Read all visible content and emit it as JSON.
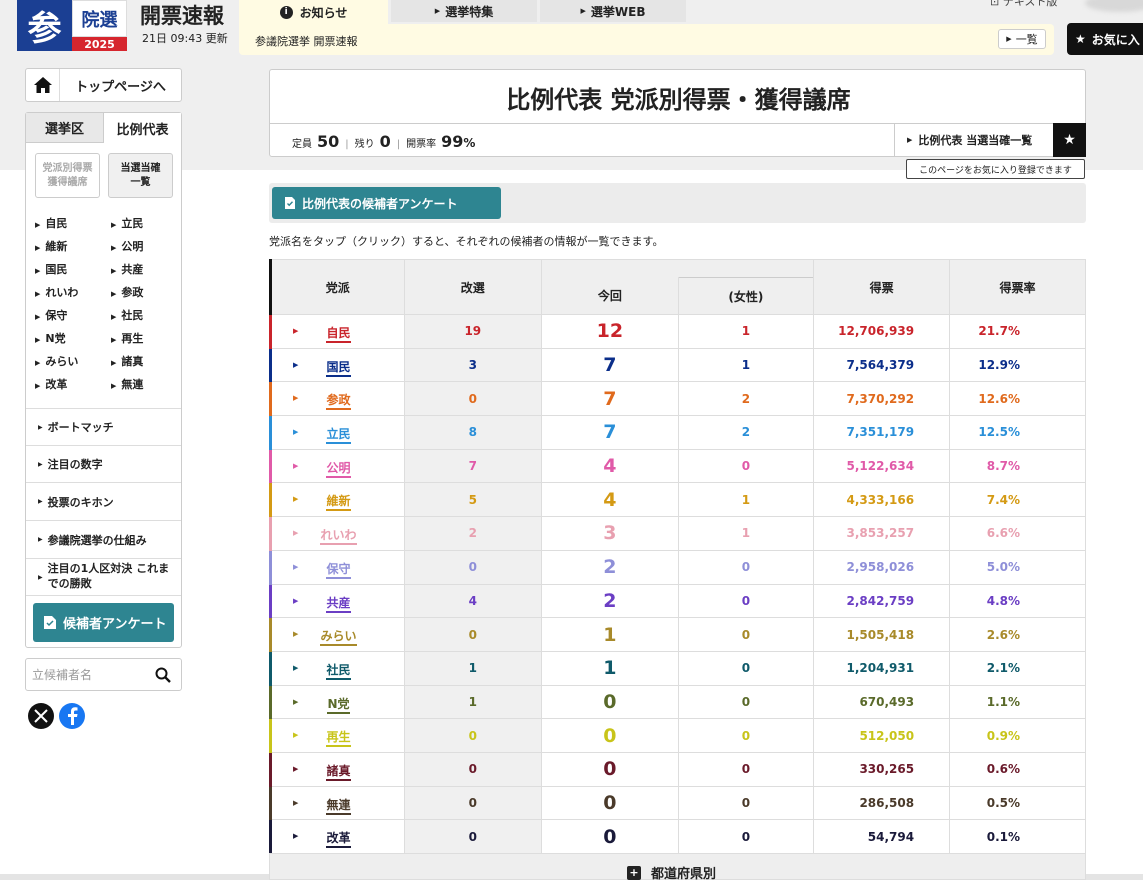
{
  "header": {
    "logo": {
      "main": "参",
      "sub": "院選",
      "year": "2025"
    },
    "title": "開票速報",
    "updated": "21日 09:43 更新",
    "tabs": [
      {
        "label": "お知らせ"
      },
      {
        "label": "選挙特集"
      },
      {
        "label": "選挙WEB"
      }
    ],
    "notice_text": "参議院選挙 開票速報",
    "notice_list_btn": "一覧",
    "text_version": "テキスト版",
    "favorite_btn": "お気に入"
  },
  "sidebar": {
    "home": "トップページへ",
    "tabs": [
      "選挙区",
      "比例代表"
    ],
    "sub_buttons": [
      {
        "line1": "党派別得票",
        "line2": "獲得議席"
      },
      {
        "line1": "当選当確",
        "line2": "一覧"
      }
    ],
    "parties": [
      "自民",
      "立民",
      "維新",
      "公明",
      "国民",
      "共産",
      "れいわ",
      "参政",
      "保守",
      "社民",
      "N党",
      "再生",
      "みらい",
      "諸真",
      "改革",
      "無連"
    ],
    "links": [
      {
        "line1": "ボートマッチ",
        "line2": ""
      },
      {
        "line1": "注目の数字",
        "line2": ""
      },
      {
        "line1": "投票のキホン",
        "line2": ""
      },
      {
        "line1": "参議院選挙の仕組み",
        "line2": ""
      },
      {
        "line1": "注目の1人区対決 これま",
        "line2": "での勝敗"
      }
    ],
    "survey_btn": "候補者アンケート",
    "search_placeholder": "立候補者名"
  },
  "main": {
    "title": "比例代表 党派別得票・獲得議席",
    "stats": {
      "teiin_label": "定員",
      "teiin": "50",
      "nokori_label": "残り",
      "nokori": "0",
      "kaihyo_label": "開票率",
      "kaihyo": "99",
      "kaihyo_unit": "%"
    },
    "kakutei_link": "比例代表 当選当確一覧",
    "tooltip": "このページをお気に入り登録できます",
    "survey_btn": "比例代表の候補者アンケート",
    "note": "党派名をタップ（クリック）すると、それぞれの候補者の情報が一覧できます。",
    "table": {
      "headers": {
        "party": "党派",
        "kaisen": "改選",
        "konkai": "今回",
        "female": "(女性)",
        "votes": "得票",
        "rate": "得票率"
      },
      "rows": [
        {
          "party": "自民",
          "kaisen": "19",
          "konkai": "12",
          "female": "1",
          "votes": "12,706,939",
          "rate": "21.7%",
          "color": "#c9242b"
        },
        {
          "party": "国民",
          "kaisen": "3",
          "konkai": "7",
          "female": "1",
          "votes": "7,564,379",
          "rate": "12.9%",
          "color": "#0b2e8a"
        },
        {
          "party": "参政",
          "kaisen": "0",
          "konkai": "7",
          "female": "2",
          "votes": "7,370,292",
          "rate": "12.6%",
          "color": "#e06a1d"
        },
        {
          "party": "立民",
          "kaisen": "8",
          "konkai": "7",
          "female": "2",
          "votes": "7,351,179",
          "rate": "12.5%",
          "color": "#2a8fd8"
        },
        {
          "party": "公明",
          "kaisen": "7",
          "konkai": "4",
          "female": "0",
          "votes": "5,122,634",
          "rate": "8.7%",
          "color": "#e05aa8"
        },
        {
          "party": "維新",
          "kaisen": "5",
          "konkai": "4",
          "female": "1",
          "votes": "4,333,166",
          "rate": "7.4%",
          "color": "#d49a14"
        },
        {
          "party": "れいわ",
          "kaisen": "2",
          "konkai": "3",
          "female": "1",
          "votes": "3,853,257",
          "rate": "6.6%",
          "color": "#e8a0b0"
        },
        {
          "party": "保守",
          "kaisen": "0",
          "konkai": "2",
          "female": "0",
          "votes": "2,958,026",
          "rate": "5.0%",
          "color": "#8e8fd8"
        },
        {
          "party": "共産",
          "kaisen": "4",
          "konkai": "2",
          "female": "0",
          "votes": "2,842,759",
          "rate": "4.8%",
          "color": "#6b3ec4"
        },
        {
          "party": "みらい",
          "kaisen": "0",
          "konkai": "1",
          "female": "0",
          "votes": "1,505,418",
          "rate": "2.6%",
          "color": "#a88a2a"
        },
        {
          "party": "社民",
          "kaisen": "1",
          "konkai": "1",
          "female": "0",
          "votes": "1,204,931",
          "rate": "2.1%",
          "color": "#0f5a6a"
        },
        {
          "party": "N党",
          "kaisen": "1",
          "konkai": "0",
          "female": "0",
          "votes": "670,493",
          "rate": "1.1%",
          "color": "#5a6a2a"
        },
        {
          "party": "再生",
          "kaisen": "0",
          "konkai": "0",
          "female": "0",
          "votes": "512,050",
          "rate": "0.9%",
          "color": "#c8c41a"
        },
        {
          "party": "諸真",
          "kaisen": "0",
          "konkai": "0",
          "female": "0",
          "votes": "330,265",
          "rate": "0.6%",
          "color": "#6a1a2a"
        },
        {
          "party": "無連",
          "kaisen": "0",
          "konkai": "0",
          "female": "0",
          "votes": "286,508",
          "rate": "0.5%",
          "color": "#4a3a2a"
        },
        {
          "party": "改革",
          "kaisen": "0",
          "konkai": "0",
          "female": "0",
          "votes": "54,794",
          "rate": "0.1%",
          "color": "#1a1a3a"
        }
      ]
    },
    "footer_label": "都道府県別"
  }
}
